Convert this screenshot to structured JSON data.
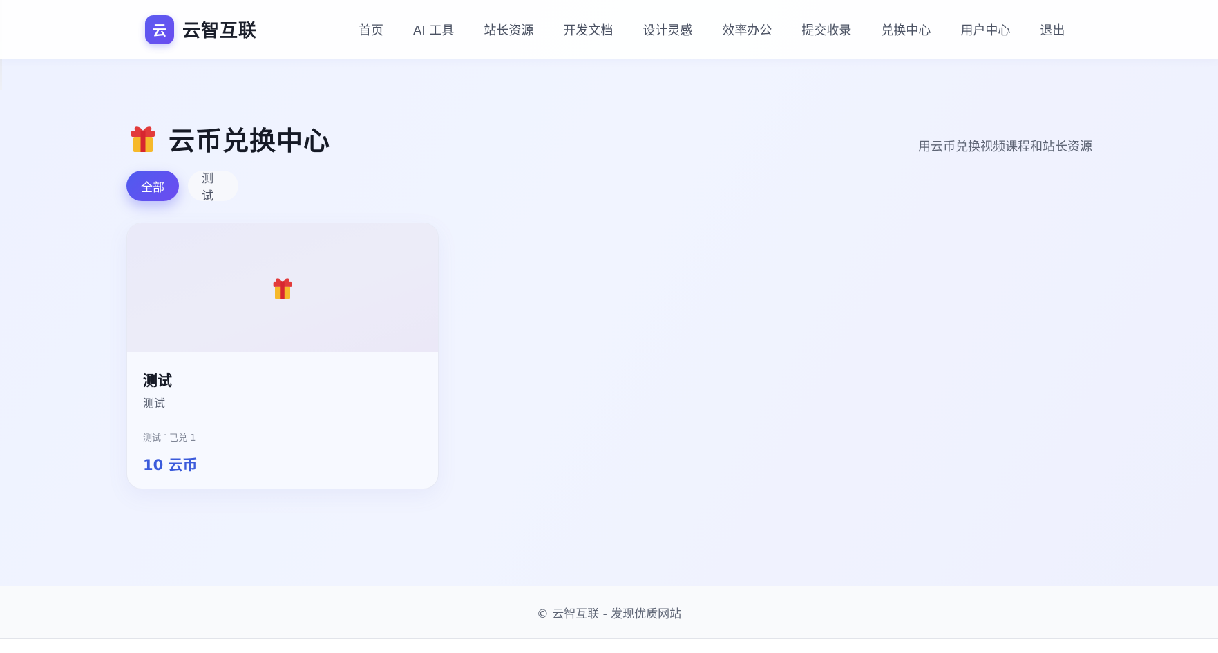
{
  "header": {
    "logo_text": "云",
    "brand_name": "云智互联",
    "nav": [
      {
        "label": "首页"
      },
      {
        "label": "AI 工具"
      },
      {
        "label": "站长资源"
      },
      {
        "label": "开发文档"
      },
      {
        "label": "设计灵感"
      },
      {
        "label": "效率办公"
      },
      {
        "label": "提交收录"
      },
      {
        "label": "兑换中心"
      },
      {
        "label": "用户中心"
      },
      {
        "label": "退出"
      }
    ]
  },
  "page": {
    "title_icon": "gift-icon",
    "title": "云币兑换中心",
    "subtitle": "用云币兑换视频课程和站长资源"
  },
  "filters": [
    {
      "label": "全部",
      "active": true
    },
    {
      "label": "测试",
      "active": false
    }
  ],
  "cards": [
    {
      "media_icon": "gift-icon",
      "title": "测试",
      "description": "测试",
      "category": "测试",
      "redeemed": "已兑 1",
      "price": "10 云币"
    }
  ],
  "footer": {
    "text": "© 云智互联 - 发现优质网站"
  },
  "colors": {
    "accent": "#5b5cf0",
    "price": "#3b5bdb"
  }
}
